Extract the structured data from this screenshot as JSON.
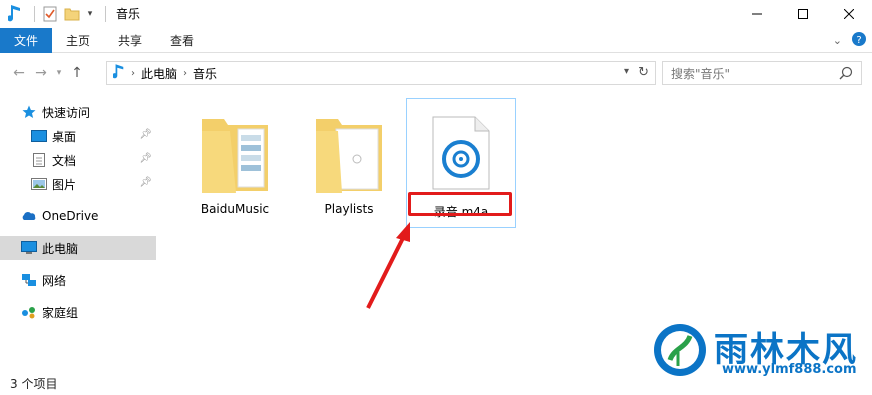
{
  "window": {
    "title": "音乐",
    "controls": [
      "minimize-icon",
      "maximize-icon",
      "close-icon"
    ]
  },
  "ribbon": {
    "file_tab": "文件",
    "tabs": [
      "主页",
      "共享",
      "查看"
    ]
  },
  "address": {
    "crumbs": [
      "此电脑",
      "音乐"
    ]
  },
  "search": {
    "placeholder": "搜索\"音乐\""
  },
  "navpane": {
    "items": [
      {
        "label": "快速访问",
        "icon": "star-icon"
      },
      {
        "label": "桌面",
        "icon": "desktop-icon",
        "pinned": true
      },
      {
        "label": "文档",
        "icon": "document-icon",
        "pinned": true
      },
      {
        "label": "图片",
        "icon": "picture-icon",
        "pinned": true
      },
      {
        "label": "OneDrive",
        "icon": "cloud-icon"
      },
      {
        "label": "此电脑",
        "icon": "computer-icon",
        "selected": true
      },
      {
        "label": "网络",
        "icon": "network-icon"
      },
      {
        "label": "家庭组",
        "icon": "homegroup-icon"
      }
    ]
  },
  "files": [
    {
      "name": "BaiduMusic",
      "type": "folder"
    },
    {
      "name": "Playlists",
      "type": "folder"
    },
    {
      "name": "录音.m4a",
      "type": "audio",
      "selected": true
    }
  ],
  "status": {
    "item_count": "3 个项目"
  },
  "watermark": {
    "text": "雨林木风",
    "url": "www.ylmf888.com"
  },
  "colors": {
    "accent": "#1979ca",
    "highlight": "#e21b1b",
    "watermark": "#0b74c6"
  }
}
